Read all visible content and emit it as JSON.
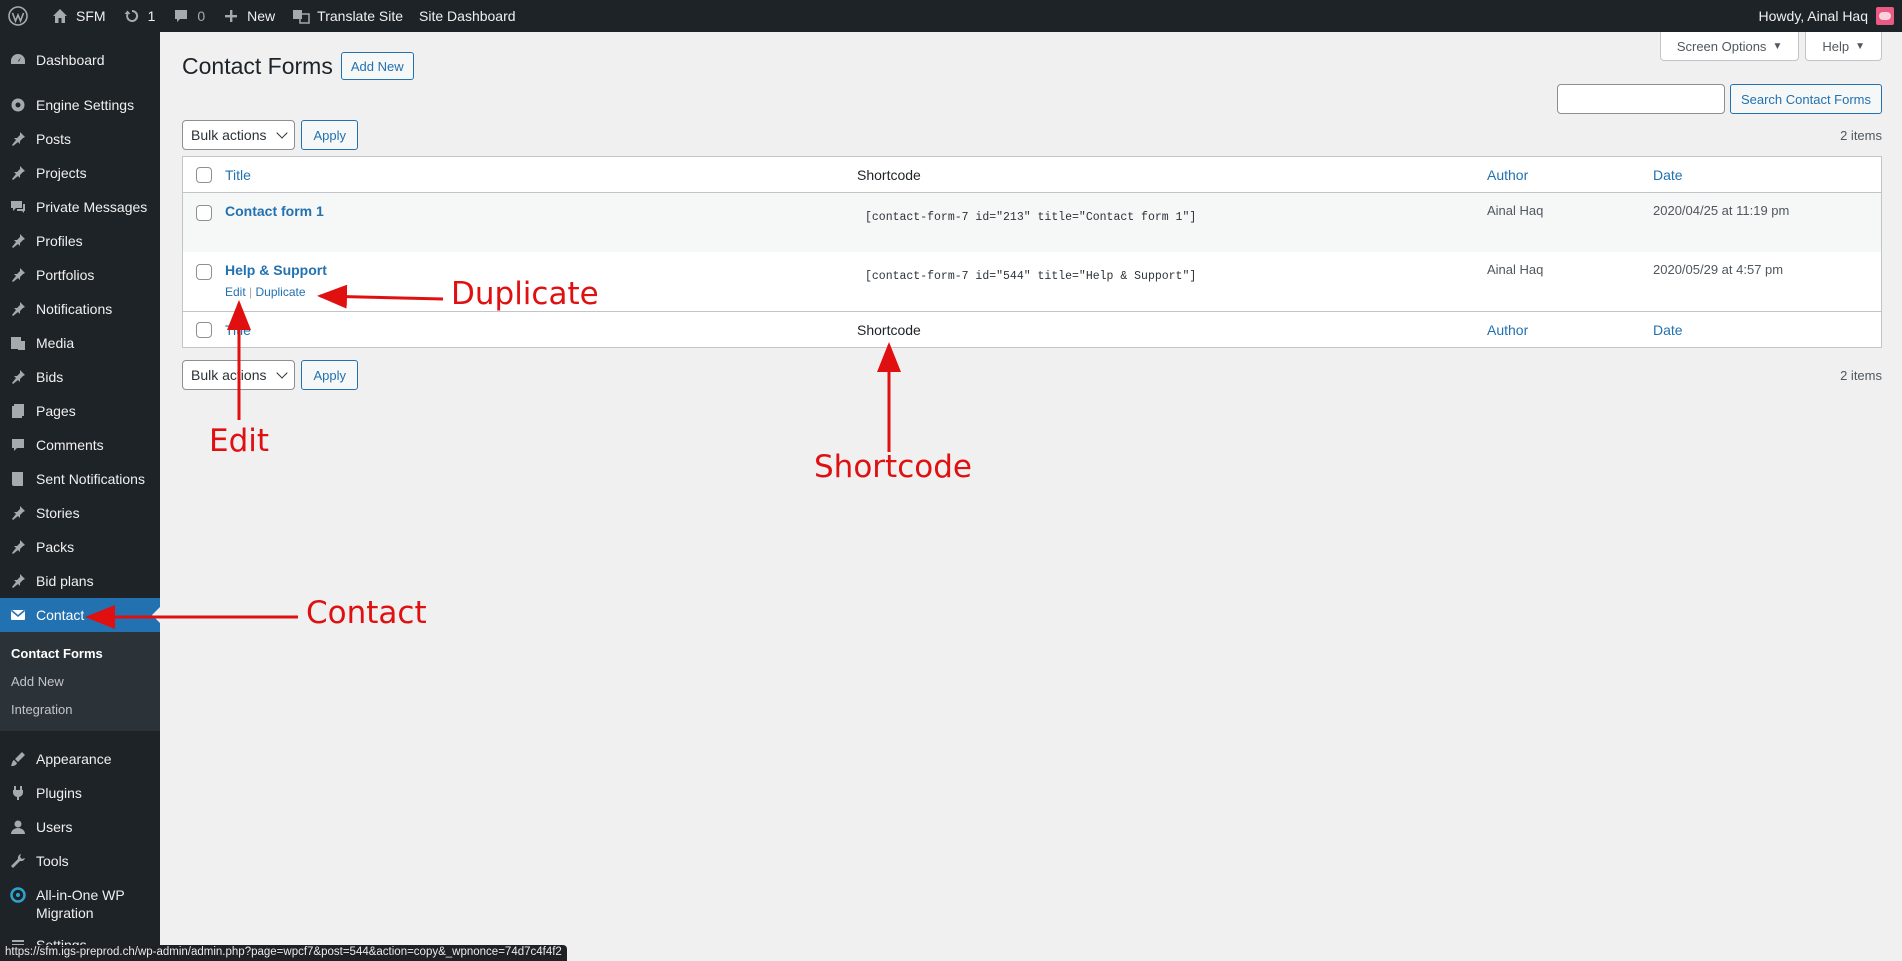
{
  "adminbar": {
    "site_name": "SFM",
    "updates_count": "1",
    "comments_count": "0",
    "new_label": "New",
    "translate_label": "Translate Site",
    "dashboard_label": "Site Dashboard",
    "greeting": "Howdy, Ainal Haq"
  },
  "sidebar": {
    "items_top": [
      {
        "label": "Dashboard",
        "icon": "dashboard-icon"
      }
    ],
    "items": [
      {
        "label": "Engine Settings",
        "icon": "gear-icon"
      },
      {
        "label": "Posts",
        "icon": "pin-icon"
      },
      {
        "label": "Projects",
        "icon": "pin-icon"
      },
      {
        "label": "Private Messages",
        "icon": "chat-icon"
      },
      {
        "label": "Profiles",
        "icon": "pin-icon"
      },
      {
        "label": "Portfolios",
        "icon": "pin-icon"
      },
      {
        "label": "Notifications",
        "icon": "pin-icon"
      },
      {
        "label": "Media",
        "icon": "media-icon"
      },
      {
        "label": "Bids",
        "icon": "pin-icon"
      },
      {
        "label": "Pages",
        "icon": "pages-icon"
      },
      {
        "label": "Comments",
        "icon": "comment-icon"
      },
      {
        "label": "Sent Notifications",
        "icon": "book-icon"
      },
      {
        "label": "Stories",
        "icon": "pin-icon"
      },
      {
        "label": "Packs",
        "icon": "pin-icon"
      },
      {
        "label": "Bid plans",
        "icon": "pin-icon"
      }
    ],
    "contact_label": "Contact",
    "submenu": [
      "Contact Forms",
      "Add New",
      "Integration"
    ],
    "items_bottom": [
      {
        "label": "Appearance",
        "icon": "brush-icon"
      },
      {
        "label": "Plugins",
        "icon": "plug-icon"
      },
      {
        "label": "Users",
        "icon": "user-icon"
      },
      {
        "label": "Tools",
        "icon": "wrench-icon"
      },
      {
        "label": "All-in-One WP Migration",
        "icon": "migration-icon"
      },
      {
        "label": "Settings",
        "icon": "settings-icon"
      }
    ]
  },
  "screen_meta": {
    "screen_options": "Screen Options",
    "help": "Help"
  },
  "page": {
    "title": "Contact Forms",
    "add_new": "Add New",
    "search_placeholder": "",
    "search_button": "Search Contact Forms",
    "bulk_actions": "Bulk actions",
    "apply": "Apply",
    "items_count": "2 items"
  },
  "table": {
    "headers": {
      "title": "Title",
      "shortcode": "Shortcode",
      "author": "Author",
      "date": "Date"
    },
    "rows": [
      {
        "title": "Contact form 1",
        "shortcode": "[contact-form-7 id=\"213\" title=\"Contact form 1\"]",
        "author": "Ainal Haq",
        "date": "2020/04/25 at 11:19 pm"
      },
      {
        "title": "Help & Support",
        "shortcode": "[contact-form-7 id=\"544\" title=\"Help & Support\"]",
        "author": "Ainal Haq",
        "date": "2020/05/29 at 4:57 pm",
        "actions": {
          "edit": "Edit",
          "duplicate": "Duplicate"
        }
      }
    ]
  },
  "annotations": {
    "duplicate": "Duplicate",
    "edit": "Edit",
    "shortcode": "Shortcode",
    "contact": "Contact"
  },
  "status_url": "https://sfm.igs-preprod.ch/wp-admin/admin.php?page=wpcf7&post=544&action=copy&_wpnonce=74d7c4f4f2",
  "colors": {
    "accent": "#2271b1",
    "sidebar": "#1d2327",
    "annotation": "#e01010"
  }
}
